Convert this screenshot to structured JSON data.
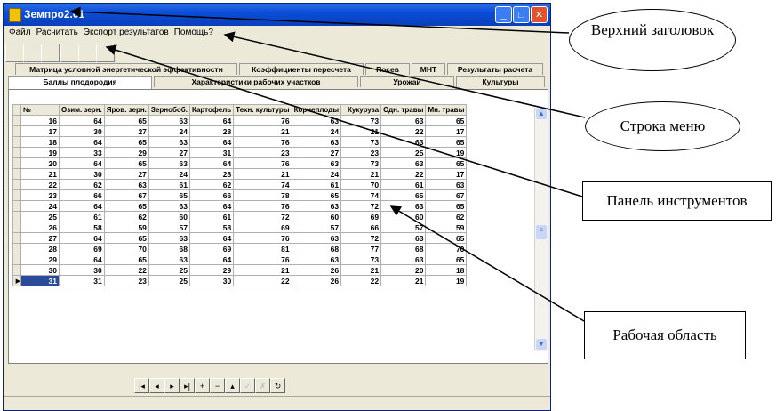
{
  "window": {
    "title": "Земпро2.01",
    "min": "_",
    "max": "□",
    "close": "✕"
  },
  "menu": [
    "Файл",
    "Расчитать",
    "Экспорт результатов",
    "Помощь?"
  ],
  "tabs_row1": [
    "Матрица условной энергетической эффективности",
    "Коэффициенты пересчета",
    "Посев",
    "МНТ",
    "Результаты расчета"
  ],
  "tabs_row2": [
    "Баллы плодородия",
    "Характеристики рабочих участков",
    "Урожай",
    "Культуры"
  ],
  "table": {
    "headers": [
      "№",
      "Озим. зерн.",
      "Яров. зерн.",
      "Зернобоб.",
      "Картофель",
      "Техн. культуры",
      "Корнеплоды",
      "Кукуруза",
      "Одн. травы",
      "Мн. травы"
    ],
    "rows": [
      [
        "16",
        "64",
        "65",
        "63",
        "64",
        "76",
        "63",
        "73",
        "63",
        "65"
      ],
      [
        "17",
        "30",
        "27",
        "24",
        "28",
        "21",
        "24",
        "21",
        "22",
        "17"
      ],
      [
        "18",
        "64",
        "65",
        "63",
        "64",
        "76",
        "63",
        "73",
        "63",
        "65"
      ],
      [
        "19",
        "33",
        "29",
        "27",
        "31",
        "23",
        "27",
        "23",
        "25",
        "19"
      ],
      [
        "20",
        "64",
        "65",
        "63",
        "64",
        "76",
        "63",
        "73",
        "63",
        "65"
      ],
      [
        "21",
        "30",
        "27",
        "24",
        "28",
        "21",
        "24",
        "21",
        "22",
        "17"
      ],
      [
        "22",
        "62",
        "63",
        "61",
        "62",
        "74",
        "61",
        "70",
        "61",
        "63"
      ],
      [
        "23",
        "66",
        "67",
        "65",
        "66",
        "78",
        "65",
        "74",
        "65",
        "67"
      ],
      [
        "24",
        "64",
        "65",
        "63",
        "64",
        "76",
        "63",
        "72",
        "63",
        "65"
      ],
      [
        "25",
        "61",
        "62",
        "60",
        "61",
        "72",
        "60",
        "69",
        "60",
        "62"
      ],
      [
        "26",
        "58",
        "59",
        "57",
        "58",
        "69",
        "57",
        "66",
        "57",
        "59"
      ],
      [
        "27",
        "64",
        "65",
        "63",
        "64",
        "76",
        "63",
        "72",
        "63",
        "65"
      ],
      [
        "28",
        "69",
        "70",
        "68",
        "69",
        "81",
        "68",
        "77",
        "68",
        "70"
      ],
      [
        "29",
        "64",
        "65",
        "63",
        "64",
        "76",
        "63",
        "73",
        "63",
        "65"
      ],
      [
        "30",
        "30",
        "22",
        "25",
        "29",
        "21",
        "26",
        "21",
        "20",
        "18"
      ],
      [
        "31",
        "31",
        "23",
        "25",
        "30",
        "22",
        "26",
        "22",
        "21",
        "19"
      ]
    ],
    "selected_row": "31"
  },
  "navigator": [
    "|◂",
    "◂",
    "▸",
    "▸|",
    "+",
    "−",
    "▴",
    "✓",
    "✗",
    "↻"
  ],
  "callouts": {
    "header": "Верхний заголовок",
    "menu": "Строка меню",
    "toolbar": "Панель инструментов",
    "workarea": "Рабочая область"
  }
}
